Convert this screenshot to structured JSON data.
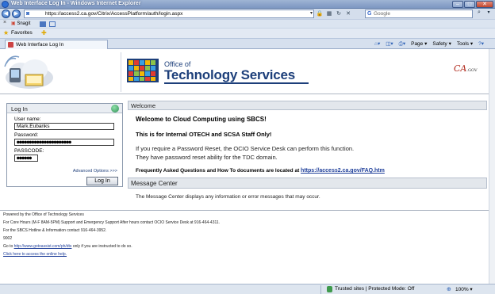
{
  "window": {
    "title": "Web Interface Log In - Windows Internet Explorer",
    "minimize": "–",
    "maximize": "□",
    "close": "✕"
  },
  "address_bar": {
    "url": "https://access2.ca.gov/Citrix/AccessPlatform/auth/login.aspx",
    "search_placeholder": "Google"
  },
  "toolbar": {
    "snagit_label": "Snagit"
  },
  "favorites_bar": {
    "label": "Favorites"
  },
  "tab": {
    "title": "Web Interface Log In"
  },
  "command_bar": {
    "page": "Page ▾",
    "safety": "Safety ▾",
    "tools": "Tools ▾",
    "help": "?▾"
  },
  "header": {
    "office_of": "Office of",
    "org_name": "Technology Services",
    "ca_logo": "CA",
    "ca_logo_suffix": ".GOV"
  },
  "login": {
    "heading": "Log In",
    "username_label": "User name:",
    "username_value": "Mark.Eubanks",
    "password_label": "Password:",
    "password_value": "●●●●●●●●●●●●●●●●●●●●●●",
    "passcode_label": "PASSCODE:",
    "passcode_value": "●●●●●●",
    "advanced_options": "Advanced Options >>>",
    "login_button": "Log In"
  },
  "welcome": {
    "heading": "Welcome",
    "title": "Welcome to Cloud Computing using SBCS!",
    "notice": "This is for Internal OTECH and SCSA Staff Only!",
    "reset_line1": "If you require a Password Reset, the OCIO Service Desk can perform this function.",
    "reset_line2": "They have password reset ability for the TDC domain.",
    "faq_text": "Frequently Asked Questions and How To documents are located at",
    "faq_link": "https://access2.ca.gov/FAQ.htm"
  },
  "message_center": {
    "heading": "Message Center",
    "text": "The Message Center displays any information or error messages that may occur."
  },
  "footer": {
    "line1": "Powered by the Office of Technology Services",
    "line2": "For Core Hours (M-F 8AM-5PM) Support and Emergency Support After hours contact OCIO Service Desk at 916-464-4311.",
    "line3": "For the SBCS Hotline & Information contact 916-464-3952.",
    "line4": "9002",
    "line5_pre": "Go to",
    "line5_link": "http://www.gotoassist.com/ph/dts",
    "line5_post": "only if you are instructed to do so.",
    "help_link": "Click here to access the online help."
  },
  "status_bar": {
    "zone": "Trusted sites | Protected Mode: Off",
    "zoom": "100% ▾"
  },
  "colors": {
    "brand_navy": "#1d3f7a",
    "ca_red": "#b12b1e",
    "link_blue": "#1f3f9a"
  }
}
